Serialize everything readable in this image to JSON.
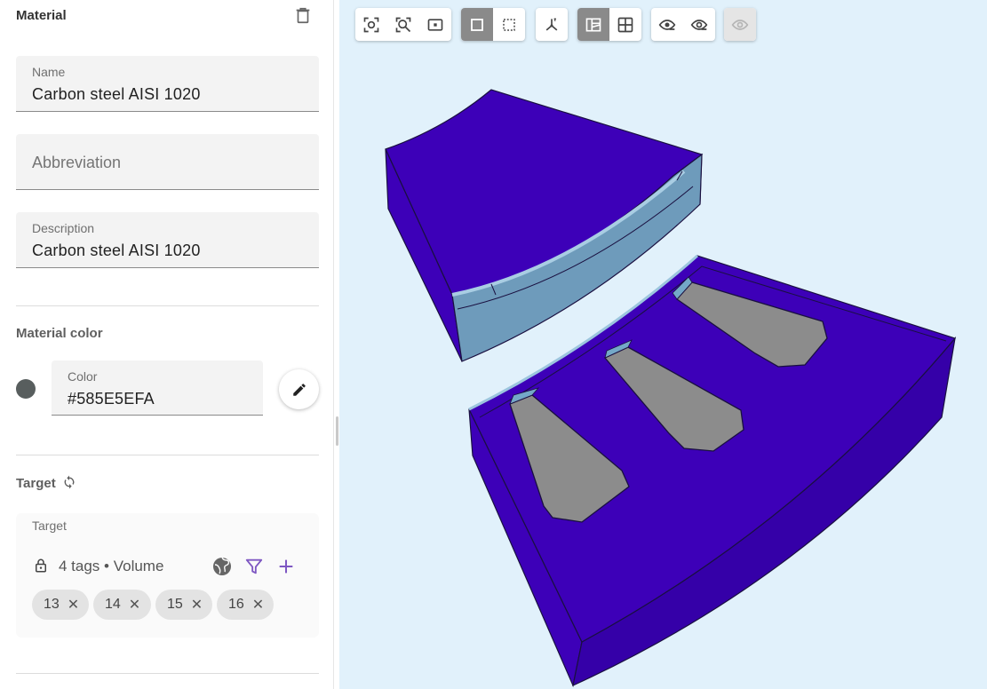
{
  "panel": {
    "title": "Material",
    "name_field": {
      "label": "Name",
      "value": "Carbon steel AISI 1020"
    },
    "abbreviation_field": {
      "placeholder": "Abbreviation",
      "value": ""
    },
    "description_field": {
      "label": "Description",
      "value": "Carbon steel AISI 1020"
    },
    "material_color": {
      "section_label": "Material color",
      "field_label": "Color",
      "value": "#585E5EFA",
      "swatch_color": "#585E5E"
    },
    "target": {
      "section_label": "Target",
      "box_label": "Target",
      "summary": "4 tags • Volume",
      "tags": [
        "13",
        "14",
        "15",
        "16"
      ]
    }
  },
  "toolbar": {
    "groups": [
      [
        "zoom-fit-icon",
        "zoom-selection-icon",
        "zoom-box-icon"
      ],
      [
        "select-single-icon",
        "select-box-icon"
      ],
      [
        "axes-icon"
      ],
      [
        "view-shaded-icon",
        "view-wireframe-icon"
      ],
      [
        "hide-icon",
        "show-icon"
      ],
      [
        "show-all-icon"
      ]
    ],
    "active": [
      "select-single-icon",
      "view-shaded-icon"
    ],
    "disabled": [
      "show-all-icon"
    ]
  },
  "colors": {
    "viewport_bg": "#E1F1FB",
    "accent": "#7E57C2",
    "volume_face": "#3D00B8",
    "selected_face": "#7A9EB5",
    "gray_face": "#8C8C8C"
  }
}
